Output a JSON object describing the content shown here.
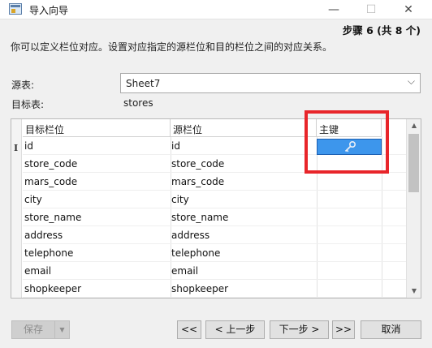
{
  "window": {
    "title": "导入向导",
    "minimize": "—",
    "maximize": "☐",
    "close": "✕"
  },
  "step": "步骤 6 (共 8 个)",
  "description": "你可以定义栏位对应。设置对应指定的源栏位和目的栏位之间的对应关系。",
  "source": {
    "label": "源表:",
    "value": "Sheet7"
  },
  "target": {
    "label": "目标表:",
    "value": "stores"
  },
  "grid": {
    "headers": [
      "目标栏位",
      "源栏位",
      "主键"
    ],
    "rows": [
      {
        "target": "id",
        "source": "id",
        "primary_key": true
      },
      {
        "target": "store_code",
        "source": "store_code",
        "primary_key": false
      },
      {
        "target": "mars_code",
        "source": "mars_code",
        "primary_key": false
      },
      {
        "target": "city",
        "source": "city",
        "primary_key": false
      },
      {
        "target": "store_name",
        "source": "store_name",
        "primary_key": false
      },
      {
        "target": "address",
        "source": "address",
        "primary_key": false
      },
      {
        "target": "telephone",
        "source": "telephone",
        "primary_key": false
      },
      {
        "target": "email",
        "source": "email",
        "primary_key": false
      },
      {
        "target": "shopkeeper",
        "source": "shopkeeper",
        "primary_key": false
      }
    ],
    "row_indicator": "I",
    "key_icon": "key-icon"
  },
  "buttons": {
    "save": "保存",
    "first": "<<",
    "prev": "< 上一步",
    "next": "下一步 >",
    "last": ">>",
    "cancel": "取消"
  },
  "colors": {
    "selected_cell": "#3d96ec",
    "highlight_box": "#e8252a"
  }
}
